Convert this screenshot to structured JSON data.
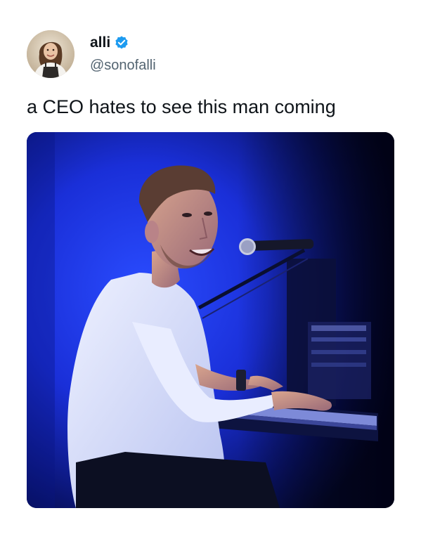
{
  "tweet": {
    "author": {
      "display_name": "alli",
      "handle": "@sonofalli",
      "verified": true,
      "avatar_icon": "profile-photo-avatar"
    },
    "text": "a CEO hates to see this man coming",
    "media": {
      "type": "photo",
      "icon": "photo-man-at-piano"
    }
  },
  "colors": {
    "text_primary": "#0f1419",
    "text_secondary": "#536471",
    "verified_blue": "#1d9bf0",
    "stage_blue": "#1a3bff"
  }
}
